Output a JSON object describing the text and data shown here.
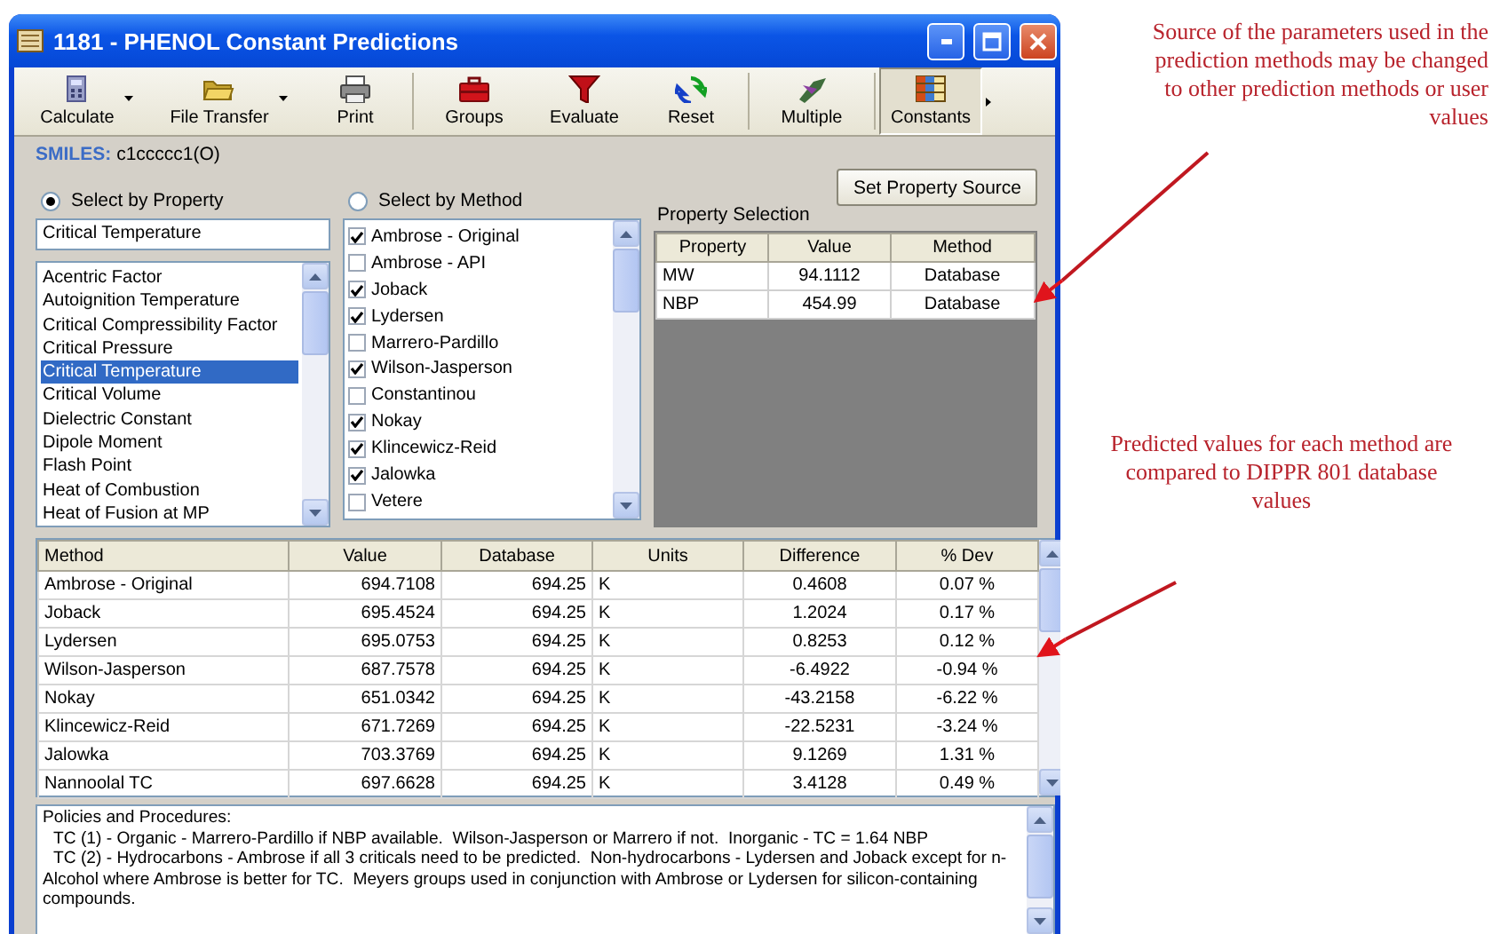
{
  "window": {
    "title": "1181 - PHENOL Constant Predictions"
  },
  "toolbar": [
    {
      "label": "Calculate",
      "dropdown": true,
      "selected": false
    },
    {
      "label": "File Transfer",
      "dropdown": true,
      "selected": false
    },
    {
      "label": "Print",
      "dropdown": false,
      "selected": false
    },
    {
      "label": "Groups",
      "dropdown": false,
      "selected": false
    },
    {
      "label": "Evaluate",
      "dropdown": false,
      "selected": false
    },
    {
      "label": "Reset",
      "dropdown": false,
      "selected": false
    },
    {
      "label": "Multiple",
      "dropdown": false,
      "selected": false
    },
    {
      "label": "Constants",
      "dropdown": false,
      "selected": true
    }
  ],
  "smiles": {
    "label": "SMILES:",
    "value": "c1ccccc1(O)"
  },
  "set_source_button": "Set Property Source",
  "modes": [
    {
      "label": "Select by Property",
      "selected": true
    },
    {
      "label": "Select by Method",
      "selected": false
    }
  ],
  "property_field": {
    "value": "Critical Temperature"
  },
  "properties": [
    {
      "label": "Acentric Factor",
      "selected": false
    },
    {
      "label": "Autoignition Temperature",
      "selected": false
    },
    {
      "label": "Critical Compressibility Factor",
      "selected": false
    },
    {
      "label": "Critical Pressure",
      "selected": false
    },
    {
      "label": "Critical Temperature",
      "selected": true
    },
    {
      "label": "Critical Volume",
      "selected": false
    },
    {
      "label": "Dielectric Constant",
      "selected": false
    },
    {
      "label": "Dipole Moment",
      "selected": false
    },
    {
      "label": "Flash Point",
      "selected": false
    },
    {
      "label": "Heat of Combustion",
      "selected": false
    },
    {
      "label": "Heat of Fusion at MP",
      "selected": false
    }
  ],
  "methods": [
    {
      "label": "Ambrose - Original",
      "checked": true
    },
    {
      "label": "Ambrose - API",
      "checked": false
    },
    {
      "label": "Joback",
      "checked": true
    },
    {
      "label": "Lydersen",
      "checked": true
    },
    {
      "label": "Marrero-Pardillo",
      "checked": false
    },
    {
      "label": "Wilson-Jasperson",
      "checked": true
    },
    {
      "label": "Constantinou",
      "checked": false
    },
    {
      "label": "Nokay",
      "checked": true
    },
    {
      "label": "Klincewicz-Reid",
      "checked": true
    },
    {
      "label": "Jalowka",
      "checked": true
    },
    {
      "label": "Vetere",
      "checked": false
    }
  ],
  "property_selection": {
    "title": "Property Selection",
    "columns": [
      "Property",
      "Value",
      "Method"
    ],
    "rows": [
      [
        "MW",
        "94.1112",
        "Database"
      ],
      [
        "NBP",
        "454.99",
        "Database"
      ]
    ]
  },
  "results": {
    "columns": [
      "Method",
      "Value",
      "Database",
      "Units",
      "Difference",
      "% Dev"
    ],
    "rows": [
      [
        "Ambrose - Original",
        "694.7108",
        "694.25",
        "K",
        "0.4608",
        "0.07 %"
      ],
      [
        "Joback",
        "695.4524",
        "694.25",
        "K",
        "1.2024",
        "0.17 %"
      ],
      [
        "Lydersen",
        "695.0753",
        "694.25",
        "K",
        "0.8253",
        "0.12 %"
      ],
      [
        "Wilson-Jasperson",
        "687.7578",
        "694.25",
        "K",
        "-6.4922",
        "-0.94 %"
      ],
      [
        "Nokay",
        "651.0342",
        "694.25",
        "K",
        "-43.2158",
        "-6.22 %"
      ],
      [
        "Klincewicz-Reid",
        "671.7269",
        "694.25",
        "K",
        "-22.5231",
        "-3.24 %"
      ],
      [
        "Jalowka",
        "703.3769",
        "694.25",
        "K",
        "9.1269",
        "1.31 %"
      ],
      [
        "Nannoolal TC",
        "697.6628",
        "694.25",
        "K",
        "3.4128",
        "0.49 %"
      ]
    ]
  },
  "policies": {
    "heading": "Policies and Procedures:",
    "items": [
      "TC (1) - Organic - Marrero-Pardillo if NBP available.  Wilson-Jasperson or Marrero if not.  Inorganic - TC = 1.64 NBP",
      "TC (2) - Hydrocarbons - Ambrose if all 3 criticals need to be predicted.  Non-hydrocarbons - Lydersen and Joback except for n-Alcohol where Ambrose is better for TC.  Meyers groups used in conjunction with Ambrose or Lydersen for silicon-containing compounds."
    ]
  },
  "annotations": [
    {
      "text": "Source of the parameters used in the prediction methods may be changed to other prediction methods or user values"
    },
    {
      "text": "Predicted values for each method are compared to DIPPR 801 database values"
    }
  ]
}
